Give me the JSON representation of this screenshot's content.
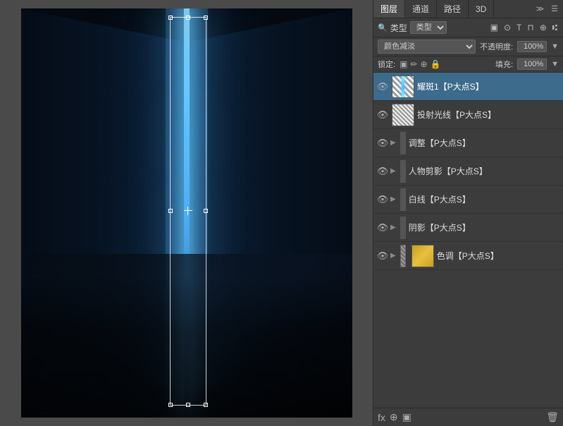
{
  "tabs": {
    "items": [
      {
        "label": "图层",
        "active": true
      },
      {
        "label": "通道",
        "active": false
      },
      {
        "label": "路径",
        "active": false
      },
      {
        "label": "3D",
        "active": false
      }
    ],
    "more_icon": "≫",
    "menu_icon": "☰"
  },
  "search": {
    "icon": "🔍",
    "label": "类型",
    "type_options": [
      "类型"
    ],
    "right_icons": [
      "▣",
      "⊙",
      "T",
      "⊓",
      "⊕",
      "⑆"
    ]
  },
  "blend_mode": {
    "label": "颜色减淡",
    "options": [
      "颜色减淡"
    ],
    "opacity_label": "不透明度:",
    "opacity_value": "100%"
  },
  "lock": {
    "label": "锁定:",
    "icons": [
      "▣",
      "✏",
      "⊕",
      "🔒"
    ],
    "fill_label": "填充:",
    "fill_value": "100%"
  },
  "layers": [
    {
      "id": "layer1",
      "visible": true,
      "has_arrow": false,
      "thumb_type": "mask-glow",
      "name": "耀斑1【P大点S】",
      "active": true
    },
    {
      "id": "layer2",
      "visible": true,
      "has_arrow": false,
      "thumb_type": "mask-dark",
      "name": "投射光线【P大点S】",
      "active": false
    },
    {
      "id": "layer3",
      "visible": true,
      "has_arrow": true,
      "thumb_type": "none",
      "name": "调整【P大点S】",
      "active": false
    },
    {
      "id": "layer4",
      "visible": true,
      "has_arrow": true,
      "thumb_type": "none",
      "name": "人物剪影【P大点S】",
      "active": false
    },
    {
      "id": "layer5",
      "visible": true,
      "has_arrow": true,
      "thumb_type": "none",
      "name": "白线【P大点S】",
      "active": false
    },
    {
      "id": "layer6",
      "visible": true,
      "has_arrow": true,
      "thumb_type": "none",
      "name": "阴影【P大点S】",
      "active": false
    },
    {
      "id": "layer7",
      "visible": true,
      "has_arrow": true,
      "thumb_type": "color-swatch",
      "name": "色调【P大点S】",
      "active": false
    }
  ],
  "bottom_toolbar": {
    "icons": [
      "fx",
      "⊕",
      "▣",
      "🗑"
    ]
  }
}
